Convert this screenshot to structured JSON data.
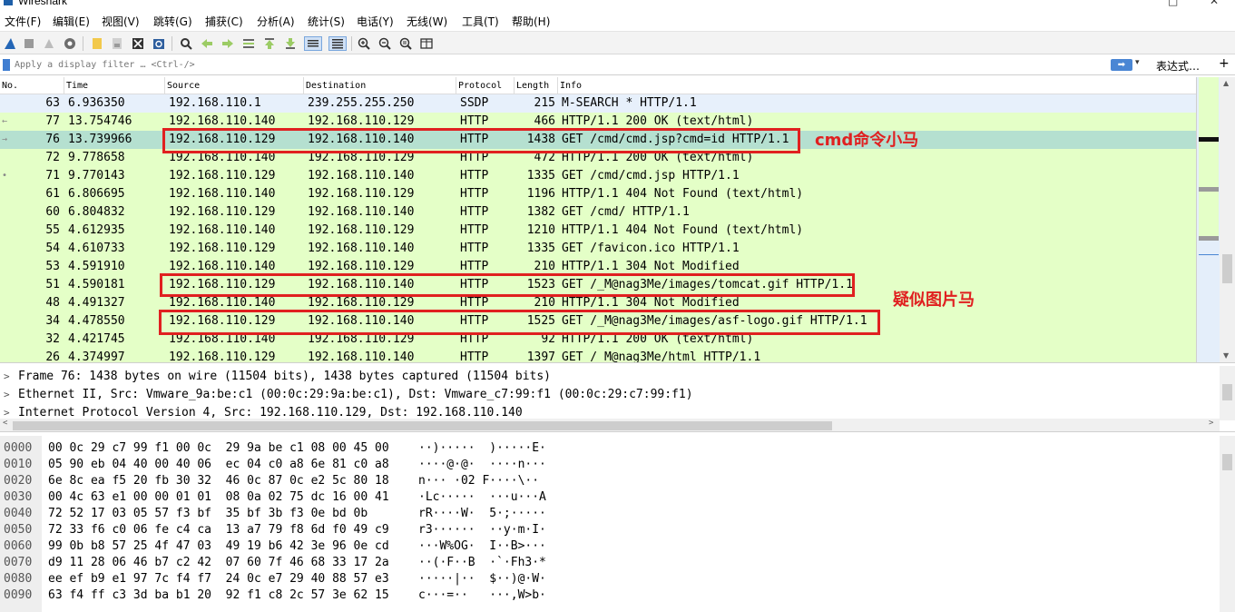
{
  "window": {
    "title": "Wireshark"
  },
  "menu": [
    "文件(F)",
    "编辑(E)",
    "视图(V)",
    "跳转(G)",
    "捕获(C)",
    "分析(A)",
    "统计(S)",
    "电话(Y)",
    "无线(W)",
    "工具(T)",
    "帮助(H)"
  ],
  "filter": {
    "placeholder": "Apply a display filter … <Ctrl-/>",
    "expression_label": "表达式…",
    "add_label": "+"
  },
  "packet_list": {
    "columns": [
      "No.",
      "Time",
      "Source",
      "Destination",
      "Protocol",
      "Length",
      "Info"
    ],
    "rows": [
      {
        "no": "63",
        "time": "6.936350",
        "src": "192.168.110.1",
        "dst": "239.255.255.250",
        "proto": "SSDP",
        "len": "215",
        "info": "M-SEARCH * HTTP/1.1",
        "bg": "#e7f0fb",
        "rel": ""
      },
      {
        "no": "77",
        "time": "13.754746",
        "src": "192.168.110.140",
        "dst": "192.168.110.129",
        "proto": "HTTP",
        "len": "466",
        "info": "HTTP/1.1 200 OK  (text/html)",
        "bg": "#e4ffc7",
        "rel": "←"
      },
      {
        "no": "76",
        "time": "13.739966",
        "src": "192.168.110.129",
        "dst": "192.168.110.140",
        "proto": "HTTP",
        "len": "1438",
        "info": "GET /cmd/cmd.jsp?cmd=id HTTP/1.1",
        "bg": "#b5e0d0",
        "rel": "→"
      },
      {
        "no": "72",
        "time": "9.778658",
        "src": "192.168.110.140",
        "dst": "192.168.110.129",
        "proto": "HTTP",
        "len": "472",
        "info": "HTTP/1.1 200 OK  (text/html)",
        "bg": "#e4ffc7",
        "rel": ""
      },
      {
        "no": "71",
        "time": "9.770143",
        "src": "192.168.110.129",
        "dst": "192.168.110.140",
        "proto": "HTTP",
        "len": "1335",
        "info": "GET /cmd/cmd.jsp HTTP/1.1",
        "bg": "#e4ffc7",
        "rel": "•"
      },
      {
        "no": "61",
        "time": "6.806695",
        "src": "192.168.110.140",
        "dst": "192.168.110.129",
        "proto": "HTTP",
        "len": "1196",
        "info": "HTTP/1.1 404 Not Found  (text/html)",
        "bg": "#e4ffc7",
        "rel": ""
      },
      {
        "no": "60",
        "time": "6.804832",
        "src": "192.168.110.129",
        "dst": "192.168.110.140",
        "proto": "HTTP",
        "len": "1382",
        "info": "GET /cmd/ HTTP/1.1",
        "bg": "#e4ffc7",
        "rel": ""
      },
      {
        "no": "55",
        "time": "4.612935",
        "src": "192.168.110.140",
        "dst": "192.168.110.129",
        "proto": "HTTP",
        "len": "1210",
        "info": "HTTP/1.1 404 Not Found  (text/html)",
        "bg": "#e4ffc7",
        "rel": ""
      },
      {
        "no": "54",
        "time": "4.610733",
        "src": "192.168.110.129",
        "dst": "192.168.110.140",
        "proto": "HTTP",
        "len": "1335",
        "info": "GET /favicon.ico HTTP/1.1",
        "bg": "#e4ffc7",
        "rel": ""
      },
      {
        "no": "53",
        "time": "4.591910",
        "src": "192.168.110.140",
        "dst": "192.168.110.129",
        "proto": "HTTP",
        "len": "210",
        "info": "HTTP/1.1 304 Not Modified",
        "bg": "#e4ffc7",
        "rel": ""
      },
      {
        "no": "51",
        "time": "4.590181",
        "src": "192.168.110.129",
        "dst": "192.168.110.140",
        "proto": "HTTP",
        "len": "1523",
        "info": "GET /_M@nag3Me/images/tomcat.gif HTTP/1.1",
        "bg": "#e4ffc7",
        "rel": ""
      },
      {
        "no": "48",
        "time": "4.491327",
        "src": "192.168.110.140",
        "dst": "192.168.110.129",
        "proto": "HTTP",
        "len": "210",
        "info": "HTTP/1.1 304 Not Modified",
        "bg": "#e4ffc7",
        "rel": ""
      },
      {
        "no": "34",
        "time": "4.478550",
        "src": "192.168.110.129",
        "dst": "192.168.110.140",
        "proto": "HTTP",
        "len": "1525",
        "info": "GET /_M@nag3Me/images/asf-logo.gif HTTP/1.1",
        "bg": "#e4ffc7",
        "rel": ""
      },
      {
        "no": "32",
        "time": "4.421745",
        "src": "192.168.110.140",
        "dst": "192.168.110.129",
        "proto": "HTTP",
        "len": "92",
        "info": "HTTP/1.1 200 OK  (text/html)",
        "bg": "#e4ffc7",
        "rel": ""
      },
      {
        "no": "26",
        "time": "4.374997",
        "src": "192.168.110.129",
        "dst": "192.168.110.140",
        "proto": "HTTP",
        "len": "1397",
        "info": "GET /_M@nag3Me/html HTTP/1.1",
        "bg": "#e4ffc7",
        "rel": ""
      }
    ]
  },
  "annotations": {
    "cmd_label": "cmd命令小马",
    "image_label": "疑似图片马",
    "color": "#e02020"
  },
  "details": [
    "Frame 76: 1438 bytes on wire (11504 bits), 1438 bytes captured (11504 bits)",
    "Ethernet II, Src: Vmware_9a:be:c1 (00:0c:29:9a:be:c1), Dst: Vmware_c7:99:f1 (00:0c:29:c7:99:f1)",
    "Internet Protocol Version 4, Src: 192.168.110.129, Dst: 192.168.110.140"
  ],
  "bytes": [
    {
      "off": "0000",
      "hex": "00 0c 29 c7 99 f1 00 0c  29 9a be c1 08 00 45 00",
      "ascii": "··)·····  )·····E·"
    },
    {
      "off": "0010",
      "hex": "05 90 eb 04 40 00 40 06  ec 04 c0 a8 6e 81 c0 a8",
      "ascii": "····@·@·  ····n···"
    },
    {
      "off": "0020",
      "hex": "6e 8c ea f5 20 fb 30 32  46 0c 87 0c e2 5c 80 18",
      "ascii": "n··· ·02 F····\\··"
    },
    {
      "off": "0030",
      "hex": "00 4c 63 e1 00 00 01 01  08 0a 02 75 dc 16 00 41",
      "ascii": "·Lc·····  ···u···A"
    },
    {
      "off": "0040",
      "hex": "72 52 17 03 05 57 f3 bf  35 bf 3b f3 0e bd 0b",
      "ascii": "rR····W·  5·;·····"
    },
    {
      "off": "0050",
      "hex": "72 33 f6 c0 06 fe c4 ca  13 a7 79 f8 6d f0 49 c9",
      "ascii": "r3······  ··y·m·I·"
    },
    {
      "off": "0060",
      "hex": "99 0b b8 57 25 4f 47 03  49 19 b6 42 3e 96 0e cd",
      "ascii": "···W%OG·  I··B>···"
    },
    {
      "off": "0070",
      "hex": "d9 11 28 06 46 b7 c2 42  07 60 7f 46 68 33 17 2a",
      "ascii": "··(·F··B  ·`·Fh3·*"
    },
    {
      "off": "0080",
      "hex": "ee ef b9 e1 97 7c f4 f7  24 0c e7 29 40 88 57 e3",
      "ascii": "·····|··  $··)@·W·"
    },
    {
      "off": "0090",
      "hex": "63 f4 ff c3 3d ba b1 20  92 f1 c8 2c 57 3e 62 15",
      "ascii": "c···=··   ···,W>b·"
    }
  ]
}
